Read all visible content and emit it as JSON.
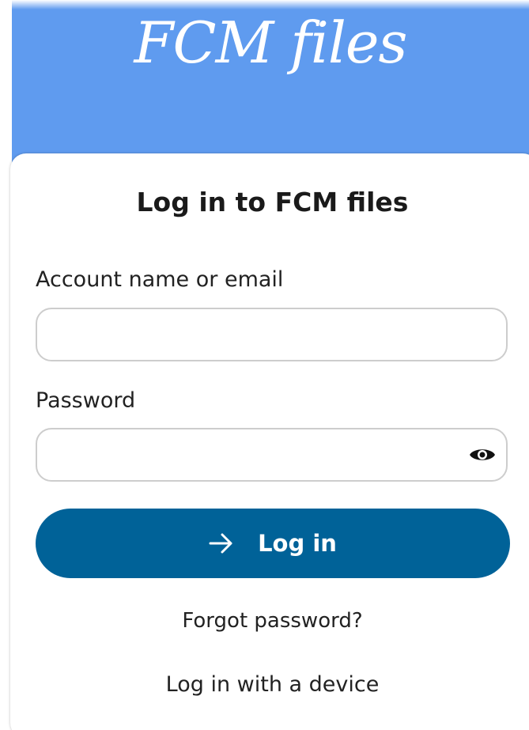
{
  "header": {
    "logo_text": "FCM files",
    "background_color": "#5f9bef"
  },
  "form": {
    "title": "Log in to FCM files",
    "account": {
      "label": "Account name or email",
      "value": "",
      "placeholder": ""
    },
    "password": {
      "label": "Password",
      "value": "",
      "placeholder": "",
      "toggle_icon": "eye-icon"
    },
    "login_button": {
      "label": "Log in",
      "icon": "arrow-right-icon",
      "color": "#006298"
    },
    "forgot_password_label": "Forgot password?",
    "device_login_label": "Log in with a device"
  }
}
